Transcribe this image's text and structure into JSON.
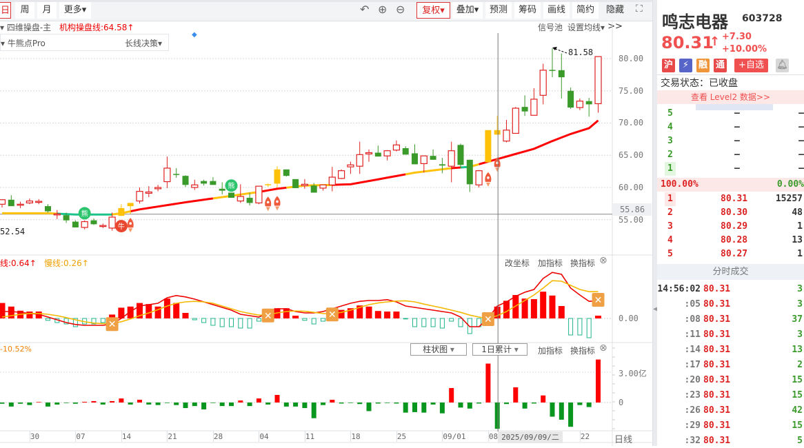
{
  "toolbar": {
    "tabs": [
      {
        "label": "日",
        "active": true
      },
      {
        "label": "周"
      },
      {
        "label": "月"
      },
      {
        "label": "更多▾"
      }
    ],
    "undo_icon": "undo-icon",
    "zoom_in_icon": "zoom-in-icon",
    "zoom_out_icon": "zoom-out-icon",
    "buttons": [
      "复权▾",
      "叠加▾",
      "预测",
      "筹码",
      "画线",
      "简约",
      "隐藏>>"
    ],
    "fullscreen_icon": "fullscreen-icon"
  },
  "main_panel": {
    "indicator_name": "▾ 四维操盘-主",
    "inst_line": "机构操盘线:64.58↑",
    "signal_pool": "信号池",
    "ma_settings": "设置均线▾",
    "overlay_name": "▾ 牛熊点Pro",
    "overlay_mode": "长线决策▾",
    "high_label": "81.58",
    "low_label": "52.54",
    "current_line_label": "55.86",
    "bear_icon_text": "熊",
    "bull_icon_text": "牛",
    "price_ticks": [
      "80.00",
      "75.00",
      "70.00",
      "65.00",
      "60.00",
      "55.00"
    ]
  },
  "macd_panel": {
    "fast_label": "线:0.64↑",
    "slow_label": "慢线:0.26↑",
    "buttons": [
      "改坐标",
      "加指标",
      "换指标"
    ],
    "zero_tick": "0.00"
  },
  "volume_panel": {
    "pct_label": "-10.52%",
    "chart_type": "柱状图",
    "period": "1日累计",
    "buttons": [
      "加指标",
      "换指标"
    ],
    "ticks": [
      "3.00亿",
      "0"
    ]
  },
  "date_axis": {
    "labels": [
      "30",
      "07",
      "14",
      "21",
      "28",
      "04",
      "11",
      "18",
      "25",
      "09/01",
      "08",
      "22"
    ],
    "label_index": [
      3,
      8,
      13,
      18,
      23,
      28,
      33,
      38,
      43,
      48,
      53,
      63
    ],
    "crosshair_date": "2025/09/09/二",
    "period": "日线"
  },
  "colors": {
    "up": "#e02020",
    "down": "#3a9a2a",
    "signal": "#ffc107",
    "accent": "#d22",
    "ma_red": "#ff0000",
    "ma_yellow": "#ffc20e",
    "ma_teal": "#1bc28a"
  },
  "chart_data": {
    "type": "candlestick",
    "ylim": [
      53,
      82
    ],
    "candles": [
      [
        57.4,
        58.1,
        56.9,
        58.1,
        "u"
      ],
      [
        58.1,
        58.8,
        57.1,
        57.1,
        "d"
      ],
      [
        57.3,
        57.8,
        56.8,
        57.4,
        "u"
      ],
      [
        57.6,
        58.3,
        57.4,
        57.9,
        "u"
      ],
      [
        57.8,
        58.2,
        57.4,
        57.85,
        "u"
      ],
      [
        57.1,
        57.4,
        56.1,
        56.3,
        "d"
      ],
      [
        55.8,
        56.5,
        55.1,
        55.9,
        "u"
      ],
      [
        55.7,
        56.1,
        54.5,
        54.9,
        "d"
      ],
      [
        54.7,
        54.9,
        53.8,
        53.8,
        "d"
      ],
      [
        53.8,
        54.9,
        53.5,
        54.7,
        "u"
      ],
      [
        54.9,
        55.2,
        54.2,
        54.3,
        "d"
      ],
      [
        54.0,
        54.4,
        53.7,
        54.1,
        "u"
      ],
      [
        53.7,
        56.1,
        53.3,
        55.4,
        "u"
      ],
      [
        55.6,
        57.4,
        55.6,
        56.8,
        "s"
      ],
      [
        57.6,
        57.6,
        55.9,
        57.1,
        "s"
      ],
      [
        57.9,
        60.0,
        57.5,
        59.4,
        "u"
      ],
      [
        59.1,
        60.2,
        58.5,
        59.3,
        "u"
      ],
      [
        59.8,
        60.4,
        59.4,
        60.0,
        "u"
      ],
      [
        60.9,
        64.8,
        59.9,
        63.0,
        "u"
      ],
      [
        62.1,
        63.0,
        61.5,
        62.0,
        "d"
      ],
      [
        61.8,
        61.9,
        60.1,
        60.4,
        "d"
      ],
      [
        60.0,
        61.2,
        59.6,
        60.4,
        "u"
      ],
      [
        61.0,
        61.2,
        60.3,
        60.6,
        "d"
      ],
      [
        61.0,
        61.6,
        60.4,
        60.4,
        "d"
      ],
      [
        59.8,
        60.8,
        58.9,
        59.5,
        "d"
      ],
      [
        59.2,
        59.2,
        58.4,
        58.4,
        "d"
      ],
      [
        57.9,
        60.5,
        57.6,
        58.6,
        "u"
      ],
      [
        58.4,
        59.2,
        57.2,
        57.6,
        "d"
      ],
      [
        57.6,
        60.2,
        57.4,
        60.2,
        "u"
      ],
      [
        60.4,
        60.6,
        60.1,
        60.5,
        "s"
      ],
      [
        60.6,
        63.3,
        60.0,
        62.8,
        "s"
      ],
      [
        62.8,
        62.8,
        61.7,
        61.8,
        "d"
      ],
      [
        61.3,
        61.3,
        59.9,
        59.9,
        "d"
      ],
      [
        60.3,
        61.3,
        59.8,
        60.5,
        "u"
      ],
      [
        60.3,
        60.7,
        59.2,
        59.2,
        "d"
      ],
      [
        59.9,
        60.4,
        59.5,
        60.4,
        "u"
      ],
      [
        60.4,
        63.2,
        59.4,
        61.6,
        "u"
      ],
      [
        61.4,
        62.8,
        61.3,
        62.6,
        "u"
      ],
      [
        63.2,
        64.0,
        62.1,
        63.5,
        "u"
      ],
      [
        63.3,
        67.1,
        62.1,
        65.1,
        "u"
      ],
      [
        65.2,
        65.9,
        64.0,
        65.4,
        "u"
      ],
      [
        65.4,
        66.5,
        64.8,
        64.8,
        "d"
      ],
      [
        64.9,
        65.8,
        64.2,
        65.7,
        "u"
      ],
      [
        65.8,
        67.3,
        65.6,
        66.6,
        "u"
      ],
      [
        66.1,
        66.4,
        65.1,
        65.1,
        "d"
      ],
      [
        65.3,
        66.7,
        63.6,
        63.6,
        "d"
      ],
      [
        63.7,
        64.8,
        62.3,
        64.9,
        "u"
      ],
      [
        64.9,
        65.9,
        64.3,
        64.3,
        "d"
      ],
      [
        63.6,
        64.6,
        62.2,
        63.4,
        "d"
      ],
      [
        63.3,
        67.1,
        60.8,
        65.7,
        "u"
      ],
      [
        66.6,
        66.8,
        63.0,
        63.5,
        "d"
      ],
      [
        64.3,
        64.3,
        59.3,
        60.5,
        "d"
      ],
      [
        60.4,
        62.7,
        60.0,
        62.6,
        "u"
      ],
      [
        63.9,
        68.9,
        63.9,
        68.9,
        "s"
      ],
      [
        68.2,
        71.1,
        68.2,
        68.9,
        "s"
      ],
      [
        67.2,
        70.5,
        67.0,
        68.9,
        "u"
      ],
      [
        68.4,
        72.5,
        68.4,
        72.3,
        "u"
      ],
      [
        72.5,
        74.3,
        71.1,
        71.8,
        "d"
      ],
      [
        71.2,
        75.4,
        71.2,
        73.7,
        "u"
      ],
      [
        74.3,
        79.2,
        72.9,
        78.2,
        "u"
      ],
      [
        78.2,
        81.58,
        77.1,
        78.25,
        "d"
      ],
      [
        78.2,
        80.8,
        73.8,
        77.1,
        "d"
      ],
      [
        75.0,
        75.5,
        72.2,
        72.4,
        "d"
      ],
      [
        72.4,
        73.8,
        72.0,
        73.4,
        "u"
      ],
      [
        73.4,
        73.9,
        71.0,
        72.9,
        "d"
      ],
      [
        73.0,
        80.31,
        71.6,
        80.31,
        "u"
      ]
    ],
    "ma_points": [
      [
        0,
        56.0
      ],
      [
        5,
        56.0
      ],
      [
        8,
        55.8
      ],
      [
        12,
        55.8
      ],
      [
        13,
        56.0
      ],
      [
        15,
        56.6
      ],
      [
        20,
        57.7
      ],
      [
        25,
        58.7
      ],
      [
        28,
        59.3
      ],
      [
        30,
        59.8
      ],
      [
        33,
        60.3
      ],
      [
        36,
        60.4
      ],
      [
        38,
        60.5
      ],
      [
        40,
        61.0
      ],
      [
        45,
        62.3
      ],
      [
        49,
        63.0
      ],
      [
        51,
        63.2
      ],
      [
        53,
        64.0
      ],
      [
        55,
        64.8
      ],
      [
        58,
        66.0
      ],
      [
        60,
        67.2
      ],
      [
        62,
        68.3
      ],
      [
        64,
        69.2
      ],
      [
        65,
        70.4
      ]
    ],
    "ma_segments": [
      [
        0,
        6,
        "y"
      ],
      [
        6,
        12,
        "t"
      ],
      [
        12,
        14,
        "y"
      ],
      [
        14,
        23,
        "r"
      ],
      [
        23,
        28,
        "y"
      ],
      [
        28,
        31,
        "r"
      ],
      [
        31,
        36,
        "y"
      ],
      [
        36,
        44,
        "r"
      ],
      [
        44,
        49,
        "y"
      ],
      [
        49,
        50,
        "r"
      ],
      [
        50,
        51,
        "t"
      ],
      [
        51,
        52,
        "y"
      ],
      [
        52,
        65,
        "r"
      ]
    ],
    "signals": [
      {
        "i": 9,
        "type": "bear",
        "price": 56.0
      },
      {
        "i": 25,
        "type": "bear",
        "price": 60.3
      },
      {
        "i": 13,
        "type": "bull",
        "price": 54.0
      },
      {
        "i": 14,
        "type": "rocket",
        "price": 54.2
      },
      {
        "i": 29,
        "type": "rocket",
        "price": 57.5
      },
      {
        "i": 30,
        "type": "rocket",
        "price": 57.6
      },
      {
        "i": 53,
        "type": "rocket",
        "price": 61.3
      },
      {
        "i": 54,
        "type": "rocket",
        "price": 63.6
      }
    ],
    "crosshair_index": 54,
    "macd_hist": [
      0.56,
      0.43,
      0.28,
      0.25,
      0.25,
      -0.07,
      -0.15,
      -0.2,
      -0.3,
      -0.2,
      -0.2,
      -0.15,
      0.14,
      0.39,
      0.43,
      0.56,
      0.52,
      0.43,
      0.72,
      0.56,
      0.2,
      -0.05,
      -0.15,
      -0.25,
      -0.3,
      -0.3,
      -0.35,
      -0.35,
      -0.1,
      0.3,
      0.37,
      0.37,
      0.1,
      -0.07,
      -0.2,
      -0.1,
      0.14,
      0.31,
      0.37,
      0.47,
      0.43,
      0.27,
      0.25,
      0.25,
      -0.02,
      -0.3,
      -0.3,
      -0.3,
      -0.35,
      -0.1,
      -0.3,
      -0.55,
      -0.3,
      0.18,
      0.43,
      0.64,
      0.85,
      0.72,
      0.7,
      0.97,
      0.83,
      0.45,
      -0.6,
      -0.6,
      -0.7,
      0.1
    ],
    "dif": [
      0.25,
      0.25,
      0.22,
      0.18,
      0.15,
      0.05,
      -0.05,
      -0.15,
      -0.22,
      -0.25,
      -0.25,
      -0.25,
      -0.2,
      0.0,
      0.25,
      0.45,
      0.5,
      0.55,
      0.75,
      0.83,
      0.78,
      0.7,
      0.6,
      0.5,
      0.4,
      0.3,
      0.15,
      0.1,
      0.05,
      0.2,
      0.35,
      0.35,
      0.25,
      0.2,
      0.2,
      0.25,
      0.35,
      0.45,
      0.55,
      0.62,
      0.65,
      0.65,
      0.68,
      0.6,
      0.45,
      0.4,
      0.35,
      0.3,
      0.25,
      0.2,
      0.05,
      -0.3,
      -0.3,
      0.0,
      0.45,
      0.6,
      0.8,
      0.95,
      1.05,
      1.45,
      1.67,
      1.6,
      1.1,
      0.85,
      0.62,
      0.64
    ],
    "dea": [
      0.05,
      0.1,
      0.15,
      0.18,
      0.18,
      0.15,
      0.1,
      0.03,
      -0.05,
      -0.12,
      -0.17,
      -0.19,
      -0.18,
      -0.12,
      -0.02,
      0.1,
      0.2,
      0.32,
      0.45,
      0.55,
      0.6,
      0.62,
      0.6,
      0.55,
      0.45,
      0.35,
      0.25,
      0.18,
      0.12,
      0.13,
      0.2,
      0.25,
      0.27,
      0.26,
      0.22,
      0.18,
      0.17,
      0.22,
      0.3,
      0.4,
      0.5,
      0.56,
      0.6,
      0.63,
      0.64,
      0.6,
      0.52,
      0.45,
      0.38,
      0.3,
      0.22,
      0.12,
      0.05,
      0.0,
      0.1,
      0.25,
      0.45,
      0.65,
      0.85,
      1.1,
      1.37,
      1.35,
      1.2,
      1.05,
      0.97,
      0.97
    ],
    "macd_cross_index": [
      12,
      29,
      36,
      53,
      65
    ],
    "volume_yi": [
      -0.12,
      -0.4,
      -0.12,
      -0.25,
      0.05,
      -0.4,
      -0.2,
      -0.05,
      -0.12,
      0.07,
      0.14,
      -0.2,
      0.14,
      0.4,
      -0.2,
      0.27,
      -0.2,
      -0.25,
      -0.05,
      -0.25,
      -0.55,
      -0.35,
      -0.68,
      -0.05,
      -0.35,
      -0.35,
      0.2,
      -0.35,
      0.4,
      -0.2,
      0.75,
      -0.4,
      -0.4,
      -0.55,
      -1.55,
      -0.25,
      0.27,
      -0.1,
      -0.05,
      -0.15,
      -0.85,
      -0.1,
      -0.05,
      -0.1,
      -1.0,
      -0.95,
      -1.0,
      -0.2,
      -1.07,
      1.43,
      -0.5,
      -0.6,
      -0.1,
      3.85,
      -2.6,
      -0.15,
      1.5,
      -0.6,
      -0.1,
      0.7,
      -1.4,
      -1.7,
      -2.4,
      -0.25,
      -0.45,
      4.25
    ]
  },
  "quote": {
    "name": "鸣志电器",
    "code": "603728",
    "price": "80.31",
    "arrow": "↑",
    "change": "+7.30",
    "change_pct": "+10.00%",
    "badges": [
      "沪",
      "⚡",
      "融",
      "通",
      "+自选"
    ],
    "bell_icon": "bell-icon",
    "status": "交易状态：已收盘",
    "level2": "查看 Level2 数据>>",
    "asks": [
      {
        "n": "5",
        "p": "—",
        "v": "—"
      },
      {
        "n": "4",
        "p": "—",
        "v": "—"
      },
      {
        "n": "3",
        "p": "—",
        "v": "—"
      },
      {
        "n": "2",
        "p": "—",
        "v": "—"
      },
      {
        "n": "1",
        "p": "—",
        "v": "—"
      }
    ],
    "ratio_left": "100.00%",
    "ratio_right": "0.00%",
    "bids": [
      {
        "n": "1",
        "p": "80.31",
        "v": "15257"
      },
      {
        "n": "2",
        "p": "80.30",
        "v": "48"
      },
      {
        "n": "3",
        "p": "80.29",
        "v": "1"
      },
      {
        "n": "4",
        "p": "80.28",
        "v": "13"
      },
      {
        "n": "5",
        "p": "80.27",
        "v": "1"
      }
    ],
    "ticks_title": "分时成交",
    "ticks": [
      {
        "t": "14:56:02",
        "p": "80.31",
        "v": "3"
      },
      {
        "t": ":05",
        "p": "80.31",
        "v": "3"
      },
      {
        "t": ":08",
        "p": "80.31",
        "v": "37"
      },
      {
        "t": ":11",
        "p": "80.31",
        "v": "3"
      },
      {
        "t": ":14",
        "p": "80.31",
        "v": "13"
      },
      {
        "t": ":17",
        "p": "80.31",
        "v": "2"
      },
      {
        "t": ":20",
        "p": "80.31",
        "v": "15"
      },
      {
        "t": ":23",
        "p": "80.31",
        "v": "15"
      },
      {
        "t": ":26",
        "p": "80.31",
        "v": "42"
      },
      {
        "t": ":29",
        "p": "80.31",
        "v": "15"
      },
      {
        "t": ":32",
        "p": "80.31",
        "v": "5"
      }
    ]
  }
}
